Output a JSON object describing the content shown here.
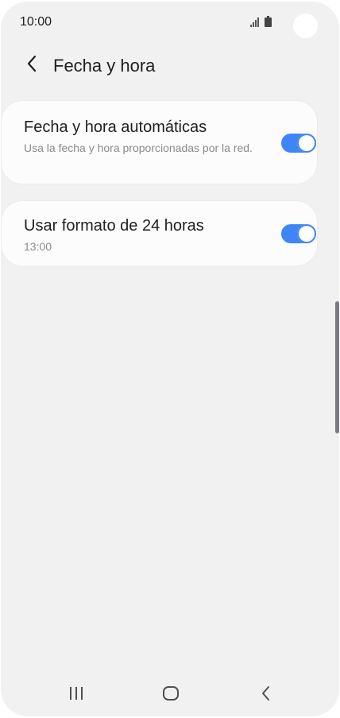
{
  "status_bar": {
    "time": "10:00"
  },
  "header": {
    "title": "Fecha y hora"
  },
  "settings": [
    {
      "title": "Fecha y hora automáticas",
      "subtitle": "Usa la fecha y hora proporcionadas por la red.",
      "enabled": true
    },
    {
      "title": "Usar formato de 24 horas",
      "subtitle": "13:00",
      "enabled": true
    }
  ],
  "colors": {
    "accent": "#3e86f5",
    "background": "#f1f1f1",
    "card": "#fcfcfc"
  },
  "icons": {
    "back": "chevron-left-icon",
    "nav_recents": "recents-icon",
    "nav_home": "home-icon",
    "nav_back": "back-icon",
    "signal": "signal-icon",
    "battery": "battery-icon"
  }
}
